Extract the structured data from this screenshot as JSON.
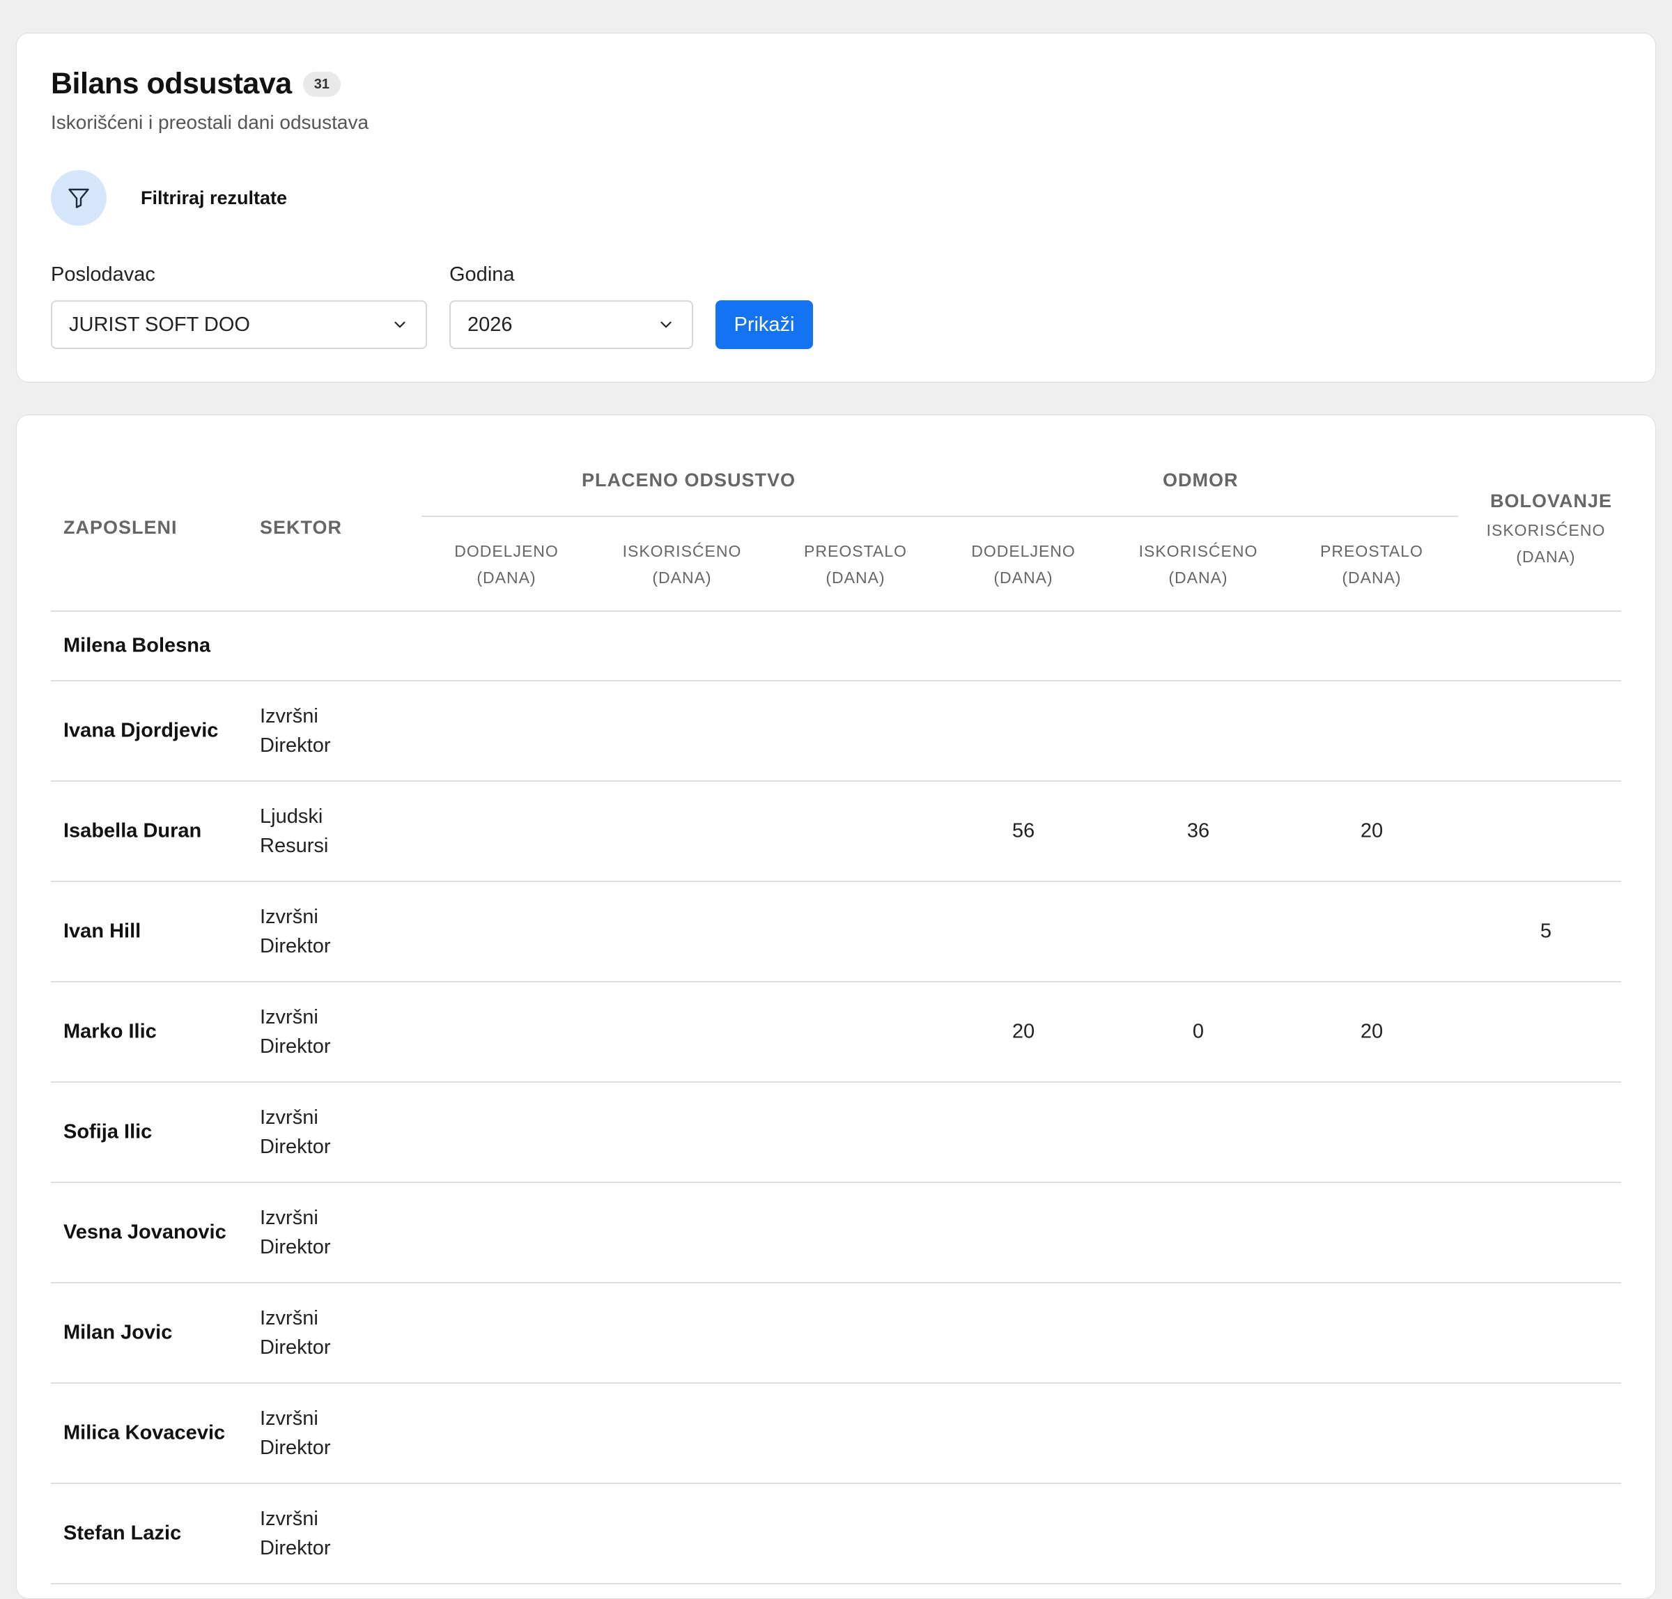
{
  "header": {
    "title": "Bilans odsustava",
    "count": "31",
    "subtitle": "Iskorišćeni i preostali dani odsustava"
  },
  "filter": {
    "label": "Filtriraj rezultate",
    "icon": "filter-icon",
    "employer_label": "Poslodavac",
    "employer_value": "JURIST SOFT DOO",
    "year_label": "Godina",
    "year_value": "2026",
    "submit_label": "Prikaži"
  },
  "colors": {
    "accent": "#1473f2",
    "filter_icon_bg": "#d5e6fb"
  },
  "table": {
    "col_employee": "ZAPOSLENI",
    "col_sector": "SEKTOR",
    "group_paid": "PLACENO ODSUSTVO",
    "group_vacation": "ODMOR",
    "group_sick": "BOLOVANJE",
    "sub_allocated": "DODELJENO (DANA)",
    "sub_used": "ISKORISĆENO (DANA)",
    "sub_remaining": "PREOSTALO (DANA)",
    "sub_sick_used": "ISKORISĆENO (DANA)",
    "rows": [
      {
        "name": "Milena Bolesna",
        "sector": "",
        "paid_alloc": "",
        "paid_used": "",
        "paid_rem": "",
        "vac_alloc": "",
        "vac_used": "",
        "vac_rem": "",
        "sick_used": ""
      },
      {
        "name": "Ivana Djordjevic",
        "sector": "Izvršni Direktor",
        "paid_alloc": "",
        "paid_used": "",
        "paid_rem": "",
        "vac_alloc": "",
        "vac_used": "",
        "vac_rem": "",
        "sick_used": ""
      },
      {
        "name": "Isabella Duran",
        "sector": "Ljudski Resursi",
        "paid_alloc": "",
        "paid_used": "",
        "paid_rem": "",
        "vac_alloc": "56",
        "vac_used": "36",
        "vac_rem": "20",
        "sick_used": ""
      },
      {
        "name": "Ivan Hill",
        "sector": "Izvršni Direktor",
        "paid_alloc": "",
        "paid_used": "",
        "paid_rem": "",
        "vac_alloc": "",
        "vac_used": "",
        "vac_rem": "",
        "sick_used": "5"
      },
      {
        "name": "Marko Ilic",
        "sector": "Izvršni Direktor",
        "paid_alloc": "",
        "paid_used": "",
        "paid_rem": "",
        "vac_alloc": "20",
        "vac_used": "0",
        "vac_rem": "20",
        "sick_used": ""
      },
      {
        "name": "Sofija Ilic",
        "sector": "Izvršni Direktor",
        "paid_alloc": "",
        "paid_used": "",
        "paid_rem": "",
        "vac_alloc": "",
        "vac_used": "",
        "vac_rem": "",
        "sick_used": ""
      },
      {
        "name": "Vesna Jovanovic",
        "sector": "Izvršni Direktor",
        "paid_alloc": "",
        "paid_used": "",
        "paid_rem": "",
        "vac_alloc": "",
        "vac_used": "",
        "vac_rem": "",
        "sick_used": ""
      },
      {
        "name": "Milan Jovic",
        "sector": "Izvršni Direktor",
        "paid_alloc": "",
        "paid_used": "",
        "paid_rem": "",
        "vac_alloc": "",
        "vac_used": "",
        "vac_rem": "",
        "sick_used": ""
      },
      {
        "name": "Milica Kovacevic",
        "sector": "Izvršni Direktor",
        "paid_alloc": "",
        "paid_used": "",
        "paid_rem": "",
        "vac_alloc": "",
        "vac_used": "",
        "vac_rem": "",
        "sick_used": ""
      },
      {
        "name": "Stefan Lazic",
        "sector": "Izvršni Direktor",
        "paid_alloc": "",
        "paid_used": "",
        "paid_rem": "",
        "vac_alloc": "",
        "vac_used": "",
        "vac_rem": "",
        "sick_used": ""
      }
    ]
  }
}
